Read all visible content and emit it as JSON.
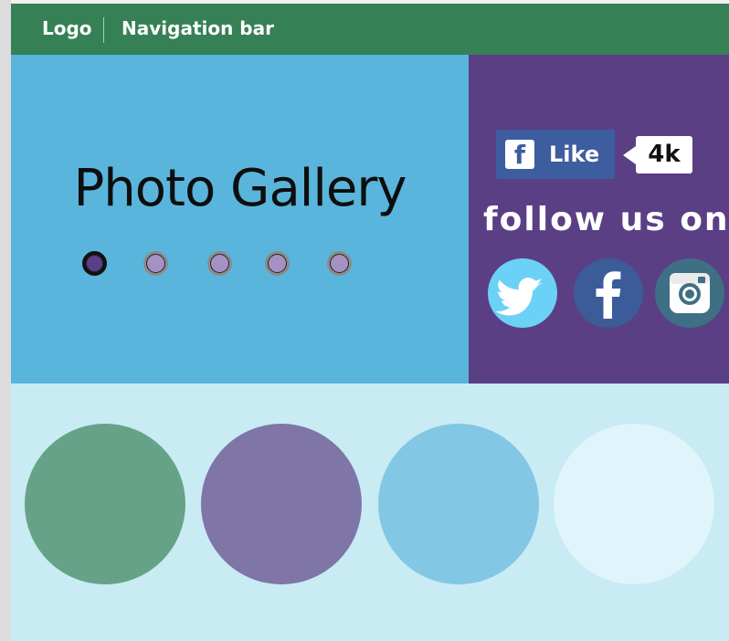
{
  "nav": {
    "logo": "Logo",
    "title": "Navigation bar"
  },
  "hero": {
    "title": "Photo Gallery",
    "active_slide": 1,
    "slide_count": 5
  },
  "social": {
    "like_label": "Like",
    "like_count": "4k",
    "follow_text": "follow us on",
    "icons": [
      "twitter-icon",
      "facebook-icon",
      "instagram-icon"
    ]
  },
  "gallery": {
    "circle_colors": [
      "#66a287",
      "#7f75a7",
      "#82c7e3",
      "#e0f4fb"
    ]
  },
  "colors": {
    "nav_bg": "#368055",
    "hero_bg": "#5ab5dc",
    "social_bg": "#5a3f85",
    "gallery_bg": "#c8ebf4"
  }
}
